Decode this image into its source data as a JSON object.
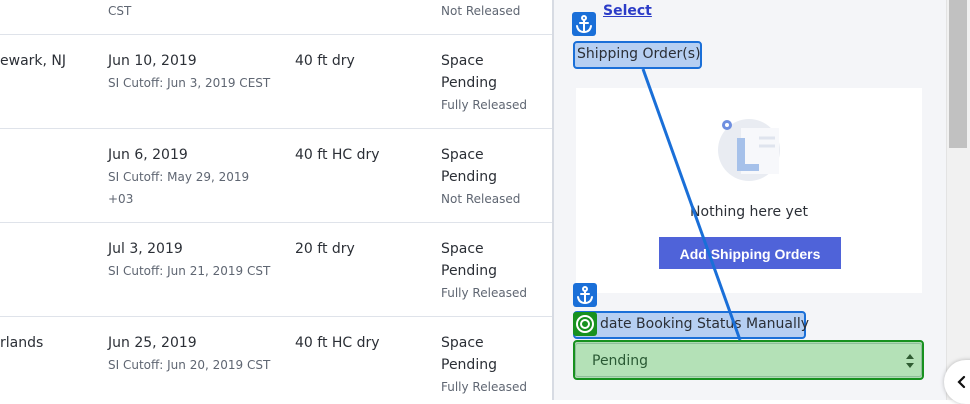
{
  "table": {
    "rows": [
      {
        "loc": "",
        "date": "",
        "cutoff": "CST",
        "container": "",
        "status1": "",
        "status2": "",
        "release": "Not Released"
      },
      {
        "loc": "ewark, NJ",
        "date": "Jun 10, 2019",
        "cutoff": "SI Cutoff: Jun 3, 2019 CEST",
        "container": "40 ft dry",
        "status1": "Space",
        "status2": "Pending",
        "release": "Fully Released"
      },
      {
        "loc": "",
        "date": "Jun 6, 2019",
        "cutoff": "SI Cutoff: May 29, 2019",
        "cutoff2": "+03",
        "container": "40 ft HC dry",
        "status1": "Space",
        "status2": "Pending",
        "release": "Not Released"
      },
      {
        "loc": "",
        "date": "Jul 3, 2019",
        "cutoff": "SI Cutoff: Jun 21, 2019 CST",
        "container": "20 ft dry",
        "status1": "Space",
        "status2": "Pending",
        "release": "Fully Released"
      },
      {
        "loc": "rlands",
        "date": "Jun 25, 2019",
        "cutoff": "SI Cutoff: Jun 20, 2019 CST",
        "container": "40 ft HC dry",
        "status1": "Space",
        "status2": "Pending",
        "release": "Fully Released"
      }
    ]
  },
  "panel": {
    "select_link": "Select",
    "shipping_orders_label": "Shipping Order(s)",
    "empty_text": "Nothing here yet",
    "add_button": "Add Shipping Orders",
    "update_label": "date Booking Status Manually",
    "status_select_value": "Pending"
  },
  "icons": {
    "anchor": "anchor-icon",
    "target": "target-icon",
    "chevron": "chevron-left-icon",
    "empty": "empty-document-icon"
  },
  "colors": {
    "accent": "#4f63d9",
    "highlight_blue": "#1a6fd8",
    "highlight_green": "#17911f"
  }
}
